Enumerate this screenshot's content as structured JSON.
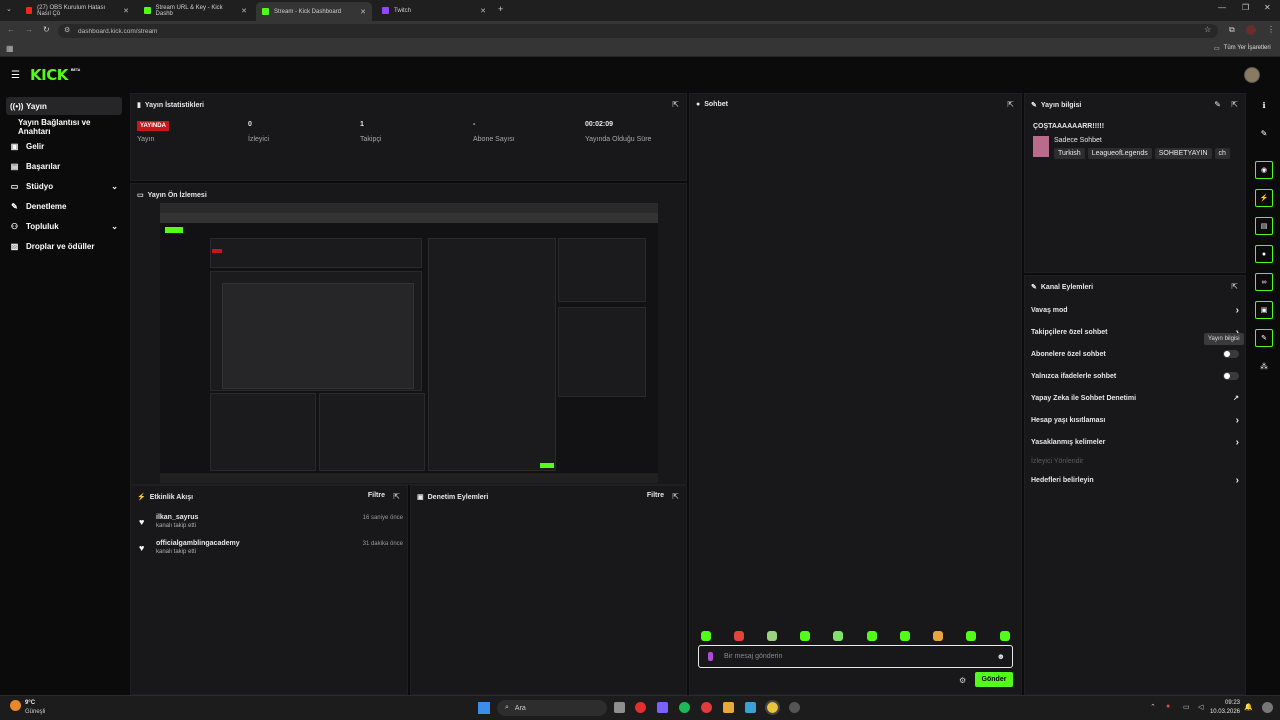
{
  "browser": {
    "tabs": [
      {
        "title": "(27) OBS Kurulum Hatası Nasıl Çö"
      },
      {
        "title": "Stream URL & Key - Kick Dashb"
      },
      {
        "title": "Stream - Kick Dashboard"
      },
      {
        "title": "Twitch"
      }
    ],
    "url": "dashboard.kick.com/stream",
    "bookmarks_label": "Tüm Yer İşaretleri"
  },
  "brand": {
    "logo": "KICK",
    "beta": "BETA",
    "accent": "#53fc18"
  },
  "nav": {
    "items": [
      {
        "label": "Yayın",
        "icon": "stream-icon"
      },
      {
        "label": "Yayın Bağlantısı ve Anahtarı"
      },
      {
        "label": "Gelir",
        "icon": "revenue-icon"
      },
      {
        "label": "Başarılar",
        "icon": "achievements-icon"
      },
      {
        "label": "Stüdyo",
        "icon": "studio-icon"
      },
      {
        "label": "Denetleme",
        "icon": "wrench-icon"
      },
      {
        "label": "Topluluk",
        "icon": "community-icon"
      },
      {
        "label": "Droplar ve ödüller",
        "icon": "gift-icon"
      }
    ]
  },
  "stats": {
    "title": "Yayın İstatistikleri",
    "items": [
      {
        "value": "YAYINDA",
        "label": "Yayın"
      },
      {
        "value": "0",
        "label": "İzleyici"
      },
      {
        "value": "1",
        "label": "Takipçi"
      },
      {
        "value": "-",
        "label": "Abone Sayısı"
      },
      {
        "value": "00:02:09",
        "label": "Yayında Olduğu Süre"
      }
    ]
  },
  "preview": {
    "title": "Yayın Ön İzlemesi"
  },
  "activity": {
    "title": "Etkinlik Akışı",
    "filter": "Filtre",
    "events": [
      {
        "name": "ilkan_sayrus",
        "sub": "kanalı takip etti",
        "time": "16 saniye önce"
      },
      {
        "name": "officialgamblingacademy",
        "sub": "kanalı takip etti",
        "time": "31 dakika önce"
      }
    ]
  },
  "moderation": {
    "title": "Denetim Eylemleri",
    "filter": "Filtre"
  },
  "chat": {
    "title": "Sohbet",
    "placeholder": "Bir mesaj gönderin",
    "send": "Gönder"
  },
  "stream_info": {
    "title": "Yayın bilgisi",
    "stream_title": "ÇOŞTAAAAAARR!!!!!",
    "category": "Sadece Sohbet",
    "tags": [
      "Turkish",
      "LeagueofLegends",
      "SOHBETYAYIN",
      "ch"
    ]
  },
  "channel_actions": {
    "title": "Kanal Eylemleri",
    "tooltip": "Yayın bilgisi",
    "items": [
      {
        "label": "Vavaş mod",
        "control": "chevron"
      },
      {
        "label": "Takipçilere özel sohbet",
        "control": "chevron"
      },
      {
        "label": "Abonelere özel sohbet",
        "control": "toggle"
      },
      {
        "label": "Yalnızca ifadelerle sohbet",
        "control": "toggle"
      },
      {
        "label": "Yapay Zeka ile Sohbet Denetimi",
        "control": "external"
      },
      {
        "label": "Hesap yaşı kısıtlaması",
        "control": "chevron"
      },
      {
        "label": "Yasaklanmış kelimeler",
        "control": "chevron"
      },
      {
        "label": "İzleyici Yönlendir",
        "control": "none",
        "disabled": true
      },
      {
        "label": "Hedefleri belirleyin",
        "control": "chevron"
      }
    ]
  },
  "taskbar": {
    "weather_temp": "9°C",
    "weather_desc": "Güneşli",
    "search": "Ara",
    "time": "09:23",
    "date": "10.03.2026"
  }
}
